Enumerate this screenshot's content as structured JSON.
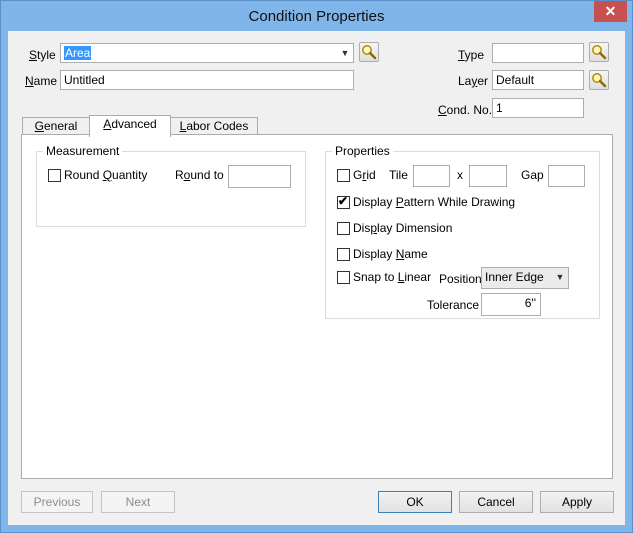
{
  "window": {
    "title": "Condition Properties",
    "close_glyph": "✕"
  },
  "form": {
    "style_label_pre": "",
    "style_label_u": "S",
    "style_label_post": "tyle",
    "style_value": "Area",
    "name_label_u": "N",
    "name_label_post": "ame",
    "name_value": "Untitled",
    "type_label_u": "T",
    "type_label_post": "ype",
    "type_value": "",
    "layer_label_pre": "La",
    "layer_label_u": "y",
    "layer_label_post": "er",
    "layer_value": "Default",
    "condno_label_u": "C",
    "condno_label_post": "ond. No.",
    "condno_value": "1",
    "combo_arrow": "▼"
  },
  "tabs": [
    {
      "pre": "",
      "u": "G",
      "post": "eneral"
    },
    {
      "pre": "",
      "u": "A",
      "post": "dvanced"
    },
    {
      "pre": "",
      "u": "L",
      "post": "abor Codes"
    }
  ],
  "measurement": {
    "title": "Measurement",
    "round_quantity_pre": "Round ",
    "round_quantity_u": "Q",
    "round_quantity_post": "uantity",
    "round_quantity_checked": false,
    "round_to_pre": "R",
    "round_to_u": "o",
    "round_to_post": "und to",
    "round_to_value": ""
  },
  "properties": {
    "title": "Properties",
    "grid_pre": "G",
    "grid_u": "r",
    "grid_post": "id",
    "grid_checked": false,
    "tile_label": "Tile",
    "tile_x_value": "",
    "x_label": "x",
    "tile_y_value": "",
    "gap_label": "Gap",
    "gap_value": "",
    "display_pattern_pre": "Display ",
    "display_pattern_u": "P",
    "display_pattern_post": "attern While Drawing",
    "display_pattern_checked": true,
    "display_dimension_pre": "Dis",
    "display_dimension_u": "p",
    "display_dimension_post": "lay Dimension",
    "display_dimension_checked": false,
    "display_name_pre": "Display ",
    "display_name_u": "N",
    "display_name_post": "ame",
    "display_name_checked": false,
    "snap_pre": "Snap to ",
    "snap_u": "L",
    "snap_post": "inear",
    "snap_checked": false,
    "position_label": "Position",
    "position_value": "Inner Edge",
    "tolerance_label": "Tolerance",
    "tolerance_value": "6''",
    "check_glyph": "✔"
  },
  "buttons": {
    "previous": "Previous",
    "next": "Next",
    "ok": "OK",
    "cancel": "Cancel",
    "apply": "Apply"
  }
}
